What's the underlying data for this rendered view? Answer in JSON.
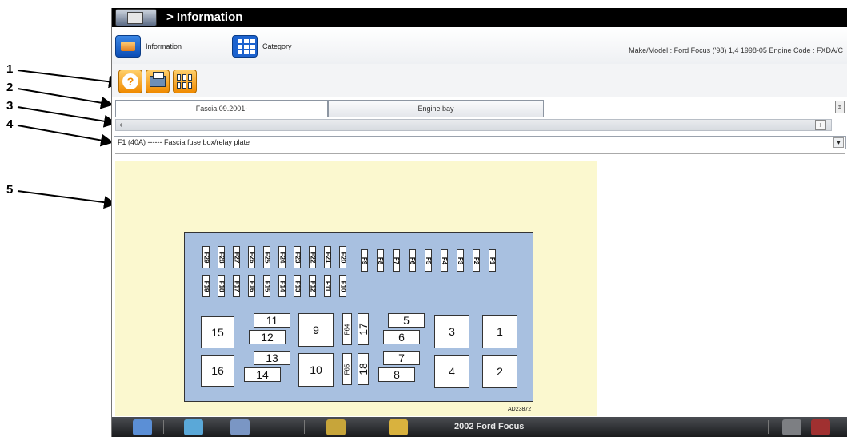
{
  "callouts": [
    "1",
    "2",
    "3",
    "4",
    "5"
  ],
  "titlebar": {
    "title": "> Information"
  },
  "nav": {
    "information_label": "Information",
    "category_label": "Category",
    "make_model": "Make/Model : Ford Focus ('98) 1,4 1998-05   Engine Code : FXDA/C"
  },
  "toolbar": {
    "icons": [
      "help-icon",
      "print-icon",
      "fuse-layout-icon"
    ]
  },
  "tabs": [
    {
      "label": "Fascia 09.2001-",
      "active": true
    },
    {
      "label": "Engine bay",
      "active": false
    }
  ],
  "select": {
    "value": "F1 (40A) ------ Fascia fuse box/relay plate"
  },
  "diagram": {
    "fuse_row_top_left": [
      "F29",
      "F28",
      "F27",
      "F26",
      "F25",
      "F24",
      "F23",
      "F22",
      "F21",
      "F20"
    ],
    "fuse_row_top_right": [
      "F9",
      "F8",
      "F7",
      "F6",
      "F5",
      "F4",
      "F3",
      "F2",
      "F1"
    ],
    "fuse_row_bottom": [
      "F19",
      "F18",
      "F17",
      "F16",
      "F15",
      "F14",
      "F13",
      "F12",
      "F11",
      "F10"
    ],
    "relays": {
      "r15": "15",
      "r16": "16",
      "r11": "11",
      "r12": "12",
      "r13": "13",
      "r14": "14",
      "r9": "9",
      "r10": "10",
      "f64": "F64",
      "f65": "F65",
      "r17": "17",
      "r18": "18",
      "r5": "5",
      "r6": "6",
      "r7": "7",
      "r8": "8",
      "r3": "3",
      "r4": "4",
      "r1": "1",
      "r2": "2"
    },
    "ref_code": "AD23872"
  },
  "taskbar": {
    "vehicle": "2002 Ford Focus"
  },
  "colors": {
    "titlebar": "#000000",
    "diagram_bg": "#fbf8cf",
    "fusebox": "#a8c0e0",
    "toolbar_accent": "#f08a00"
  }
}
